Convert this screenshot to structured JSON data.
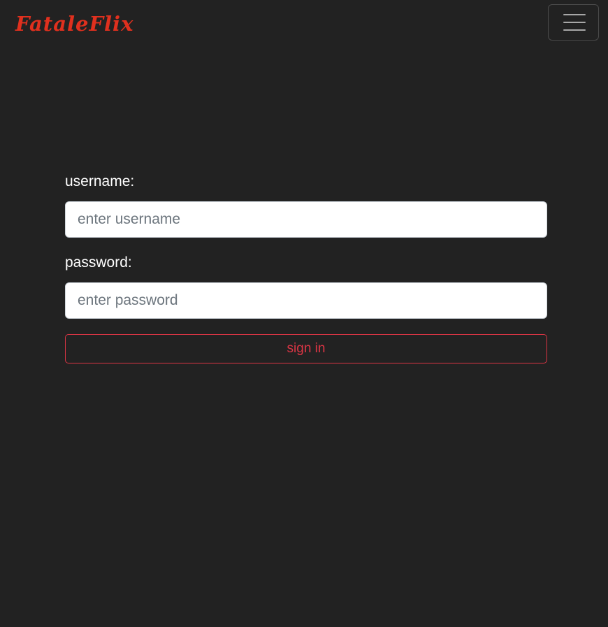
{
  "navbar": {
    "brand": "FataleFlix",
    "brand_color": "#e0301e",
    "toggler_icon": "hamburger-menu-icon"
  },
  "form": {
    "username_label": "username:",
    "username_placeholder": "enter username",
    "username_value": "",
    "password_label": "password:",
    "password_placeholder": "enter password",
    "password_value": "",
    "submit_label": "sign in",
    "submit_color": "#dc3545"
  },
  "theme": {
    "background": "#222222"
  }
}
